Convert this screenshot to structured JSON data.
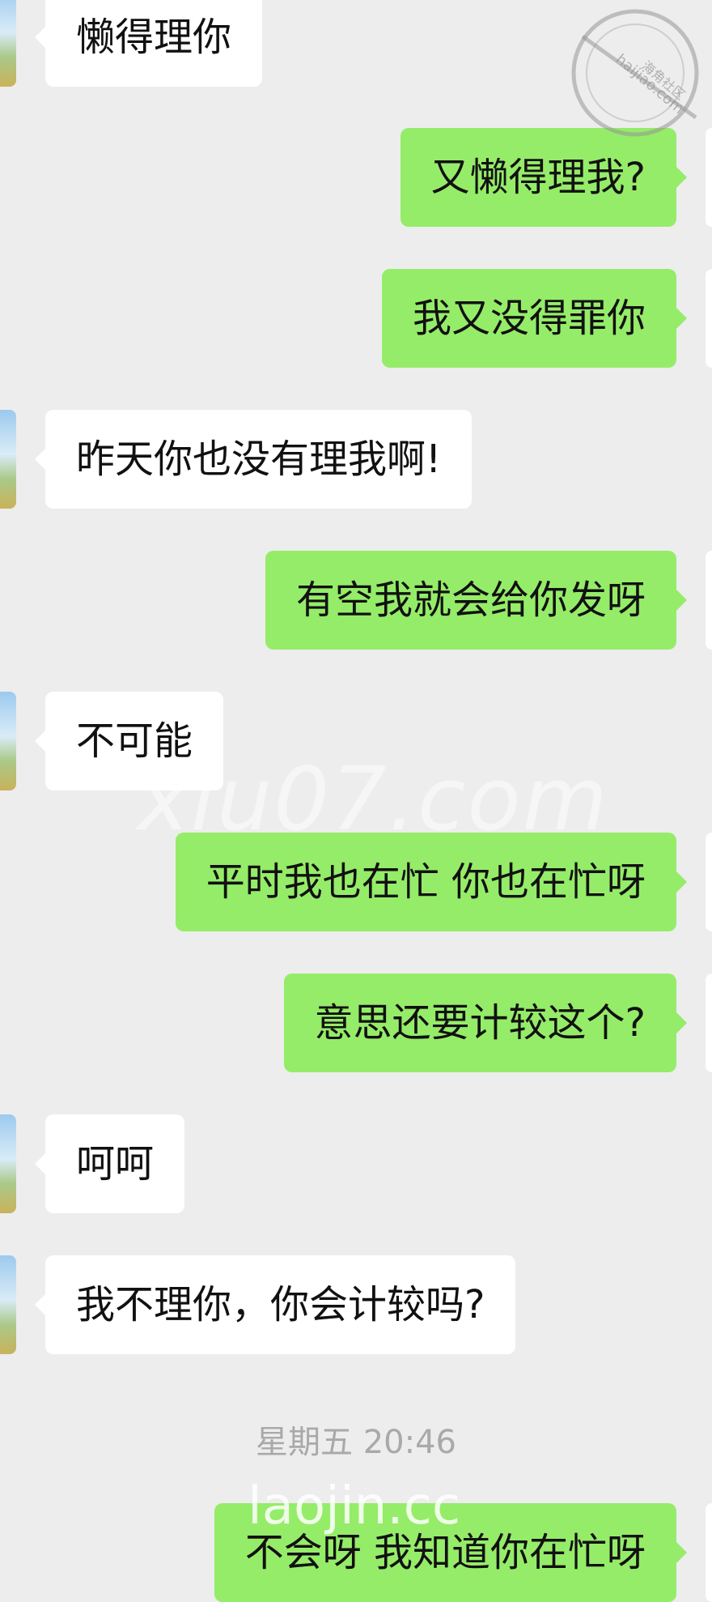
{
  "messages": [
    {
      "side": "in",
      "text": "懒得理你"
    },
    {
      "side": "out",
      "text": "又懒得理我?"
    },
    {
      "side": "out",
      "text": "我又没得罪你"
    },
    {
      "side": "in",
      "text": "昨天你也没有理我啊!"
    },
    {
      "side": "out",
      "text": "有空我就会给你发呀"
    },
    {
      "side": "in",
      "text": "不可能"
    },
    {
      "side": "out",
      "text": "平时我也在忙 你也在忙呀"
    },
    {
      "side": "out",
      "text": "意思还要计较这个?"
    },
    {
      "side": "in",
      "text": "呵呵"
    },
    {
      "side": "in",
      "text": "我不理你，你会计较吗?"
    },
    {
      "side": "out",
      "text": "不会呀 我知道你在忙呀"
    }
  ],
  "timestamp": "星期五 20:46",
  "watermarks": {
    "center": "xiu07.com",
    "bottom": "laojin.cc",
    "seal_text": "海角社区",
    "seal_url": "haijiao.com"
  }
}
